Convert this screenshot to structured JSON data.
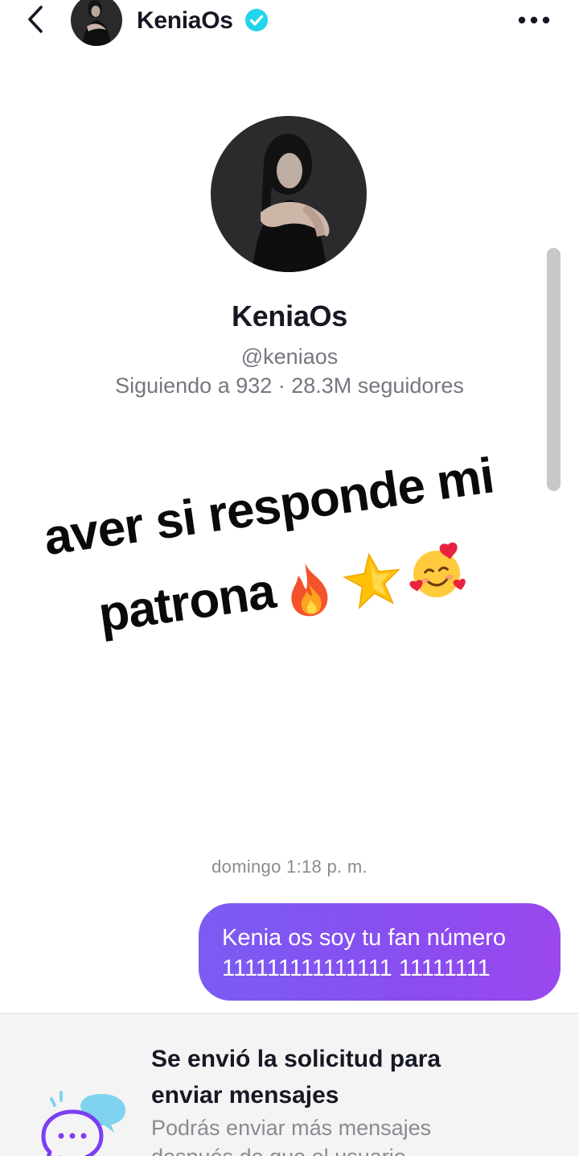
{
  "header": {
    "name": "KeniaOs",
    "verified": true,
    "icons": {
      "back": "back-chevron-icon",
      "verified": "verified-badge-icon",
      "more": "more-options-icon"
    }
  },
  "profile": {
    "name": "KeniaOs",
    "handle": "@keniaos",
    "stats": "Siguiendo a 932 · 28.3M seguidores"
  },
  "overlay": {
    "line1": "aver si responde mi",
    "line2": "patrona",
    "emojis": [
      "fire-emoji",
      "star-emoji",
      "smiling-face-with-hearts-emoji"
    ]
  },
  "chat": {
    "timestamp": "domingo 1:18 p. m.",
    "messages": [
      {
        "from": "me",
        "line1": "Kenia os soy tu fan número",
        "line2": "111111111111111 11111111"
      }
    ]
  },
  "request_notice": {
    "title_line1": "Se envió la solicitud para",
    "title_line2": "enviar mensajes",
    "subtitle_line1": "Podrás enviar más mensajes",
    "subtitle_line2": "después de que el usuario",
    "icon": "message-request-icon"
  },
  "colors": {
    "bubble_start": "#7a5cf3",
    "bubble_end": "#9a48ee",
    "verified": "#20d5ec",
    "panel_bg": "#f4f4f5"
  }
}
